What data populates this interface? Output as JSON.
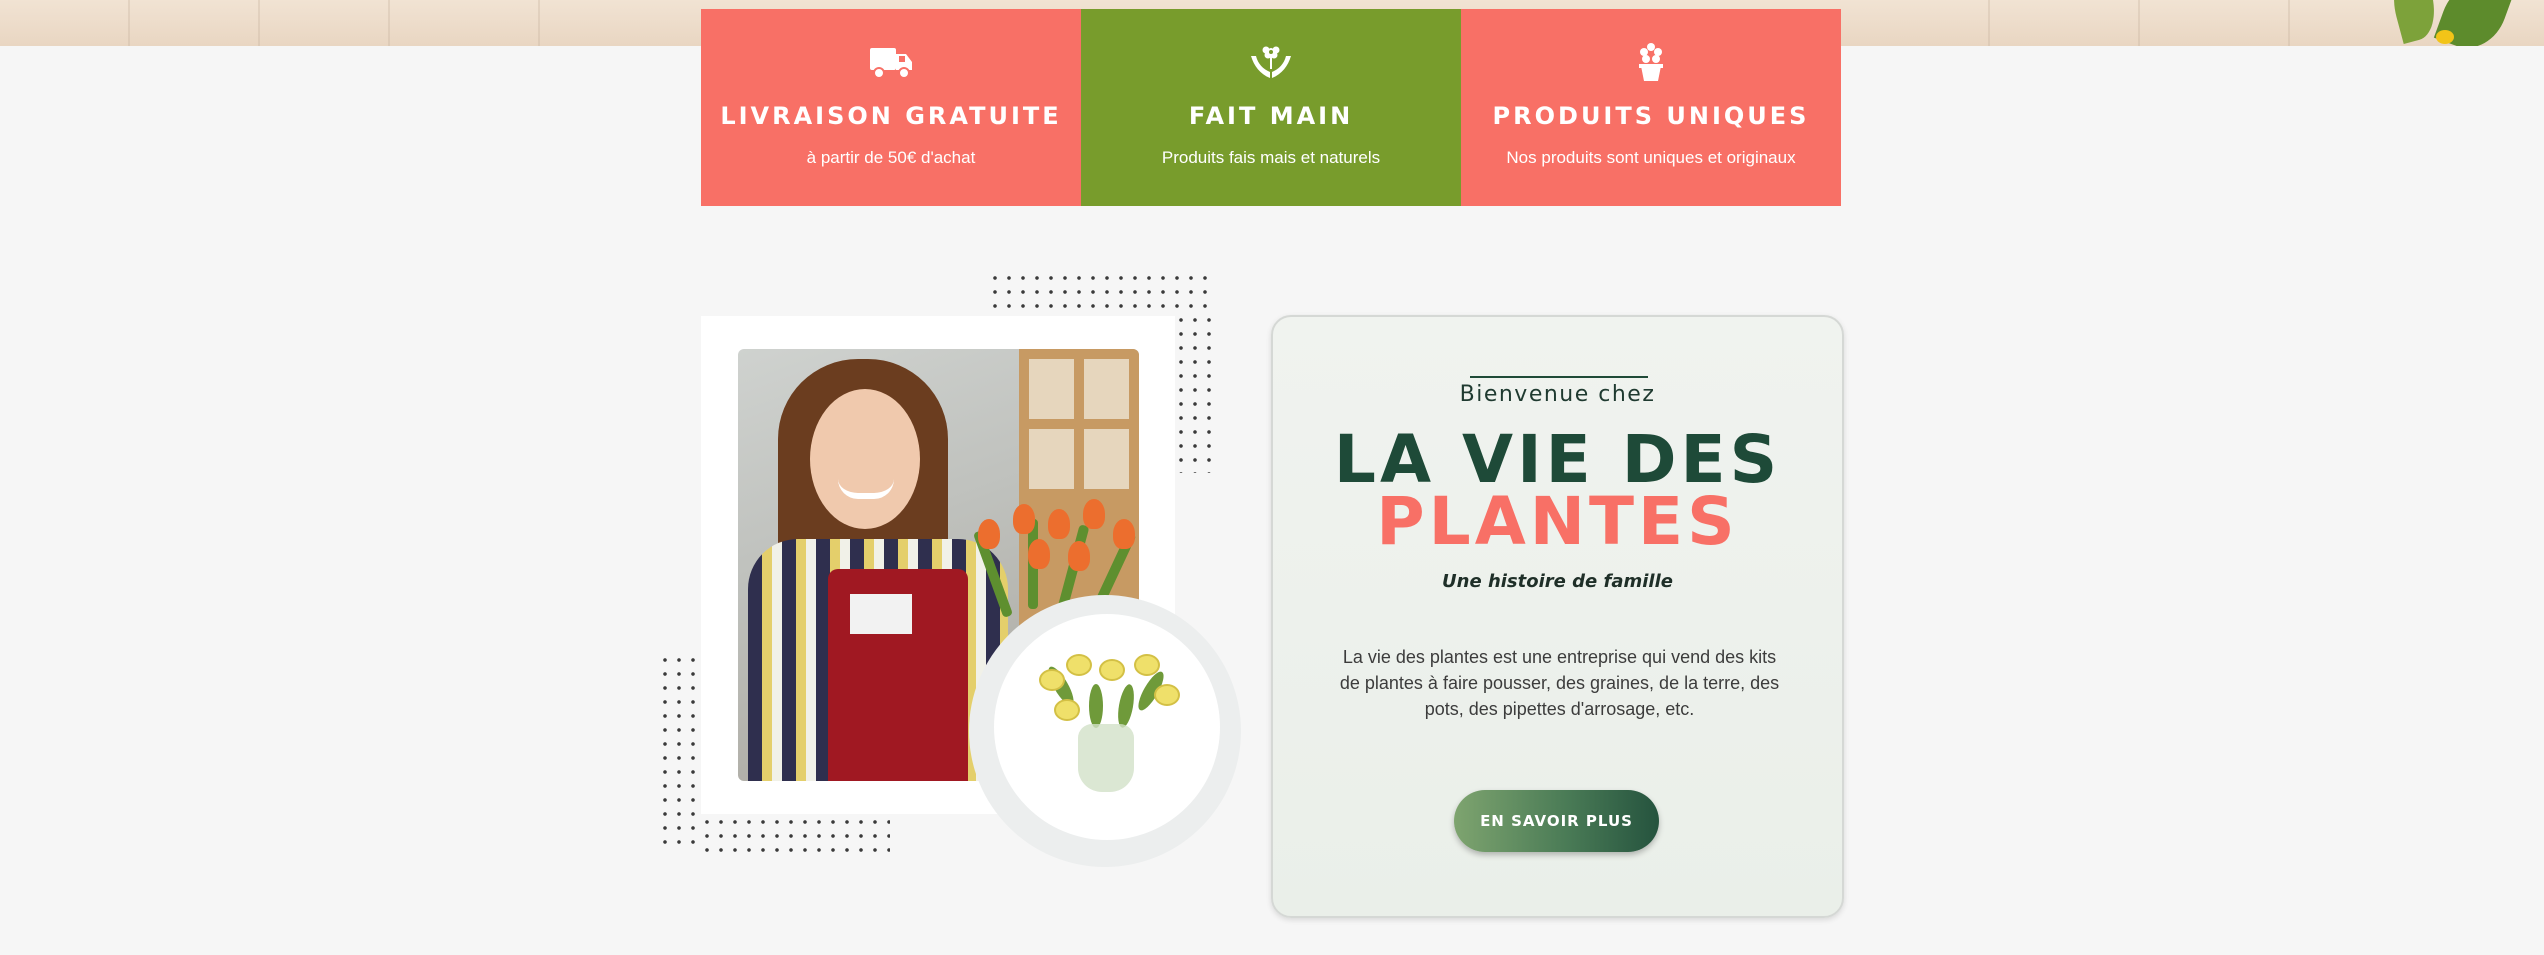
{
  "features": [
    {
      "icon": "delivery-truck-icon",
      "title": "LIVRAISON GRATUITE",
      "subtitle": "à partir de 50€ d'achat",
      "color": "#f87066"
    },
    {
      "icon": "hands-flower-icon",
      "title": "FAIT MAIN",
      "subtitle": "Produits fais mais et naturels",
      "color": "#789c2c"
    },
    {
      "icon": "flower-pot-icon",
      "title": "PRODUITS UNIQUES",
      "subtitle": "Nos produits sont uniques et originaux",
      "color": "#f87066"
    }
  ],
  "about": {
    "kicker": "Bienvenue chez",
    "title_line1": "LA VIE DES",
    "title_line2": "PLANTES",
    "tagline": "Une histoire de famille",
    "description": "La vie des plantes est une entreprise qui vend des kits de plantes à faire pousser, des graines, de la terre, des pots, des pipettes d'arrosage, etc.",
    "button_label": "EN SAVOIR PLUS"
  },
  "colors": {
    "coral": "#f87066",
    "green": "#789c2c",
    "dark_green": "#1e4a38",
    "background": "#f6f6f6"
  }
}
